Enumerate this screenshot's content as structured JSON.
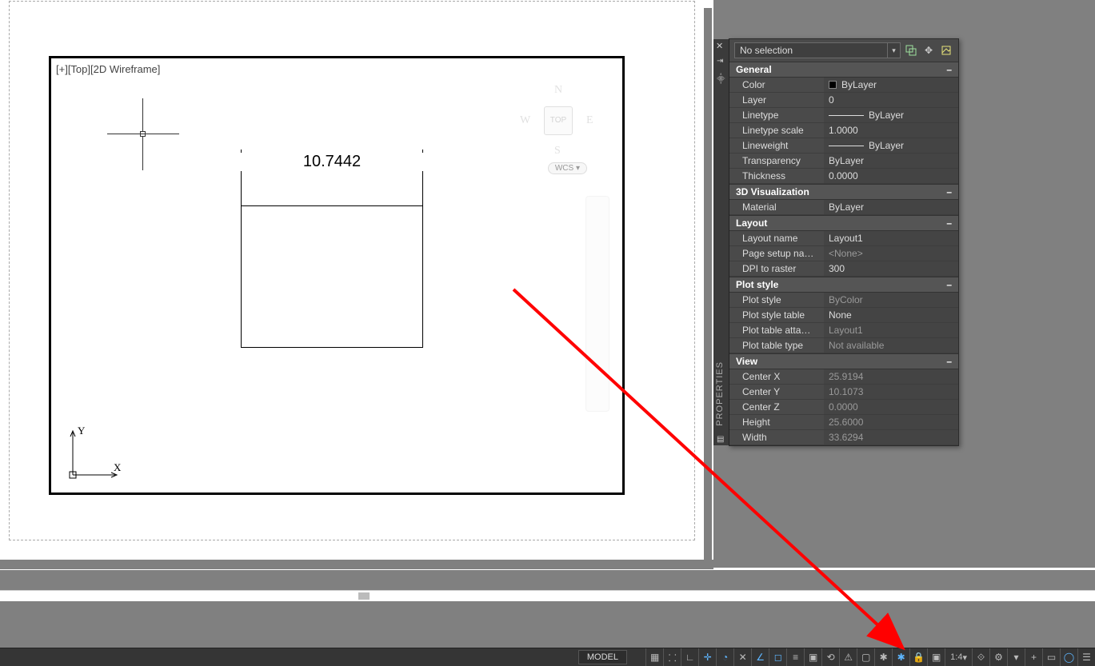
{
  "viewport": {
    "label": "[+][Top][2D Wireframe]",
    "viewcube_top": "TOP",
    "wcs": "WCS"
  },
  "dimension": {
    "value": "10.7442"
  },
  "panel": {
    "vtitle": "PROPERTIES",
    "selection": "No selection",
    "sections": {
      "general": {
        "title": "General",
        "color": "ByLayer",
        "layer": "0",
        "linetype": "ByLayer",
        "linetype_scale": "1.0000",
        "lineweight": "ByLayer",
        "transparency": "ByLayer",
        "thickness": "0.0000"
      },
      "viz": {
        "title": "3D Visualization",
        "material": "ByLayer"
      },
      "layout": {
        "title": "Layout",
        "layout_name": "Layout1",
        "page_setup": "<None>",
        "dpi": "300"
      },
      "plot": {
        "title": "Plot style",
        "plot_style": "ByColor",
        "table": "None",
        "attached": "Layout1",
        "table_type": "Not available"
      },
      "view": {
        "title": "View",
        "cx": "25.9194",
        "cy": "10.1073",
        "cz": "0.0000",
        "height": "25.6000",
        "width": "33.6294"
      }
    },
    "labels": {
      "color": "Color",
      "layer": "Layer",
      "linetype": "Linetype",
      "linetype_scale": "Linetype scale",
      "lineweight": "Lineweight",
      "transparency": "Transparency",
      "thickness": "Thickness",
      "material": "Material",
      "layout_name": "Layout name",
      "page_setup": "Page setup na…",
      "dpi": "DPI to raster",
      "plot_style": "Plot style",
      "plot_table": "Plot style table",
      "plot_attached": "Plot table atta…",
      "plot_type": "Plot table type",
      "cx": "Center X",
      "cy": "Center Y",
      "cz": "Center Z",
      "height": "Height",
      "width": "Width"
    }
  },
  "status": {
    "model": "MODEL",
    "scale": "1:4"
  }
}
